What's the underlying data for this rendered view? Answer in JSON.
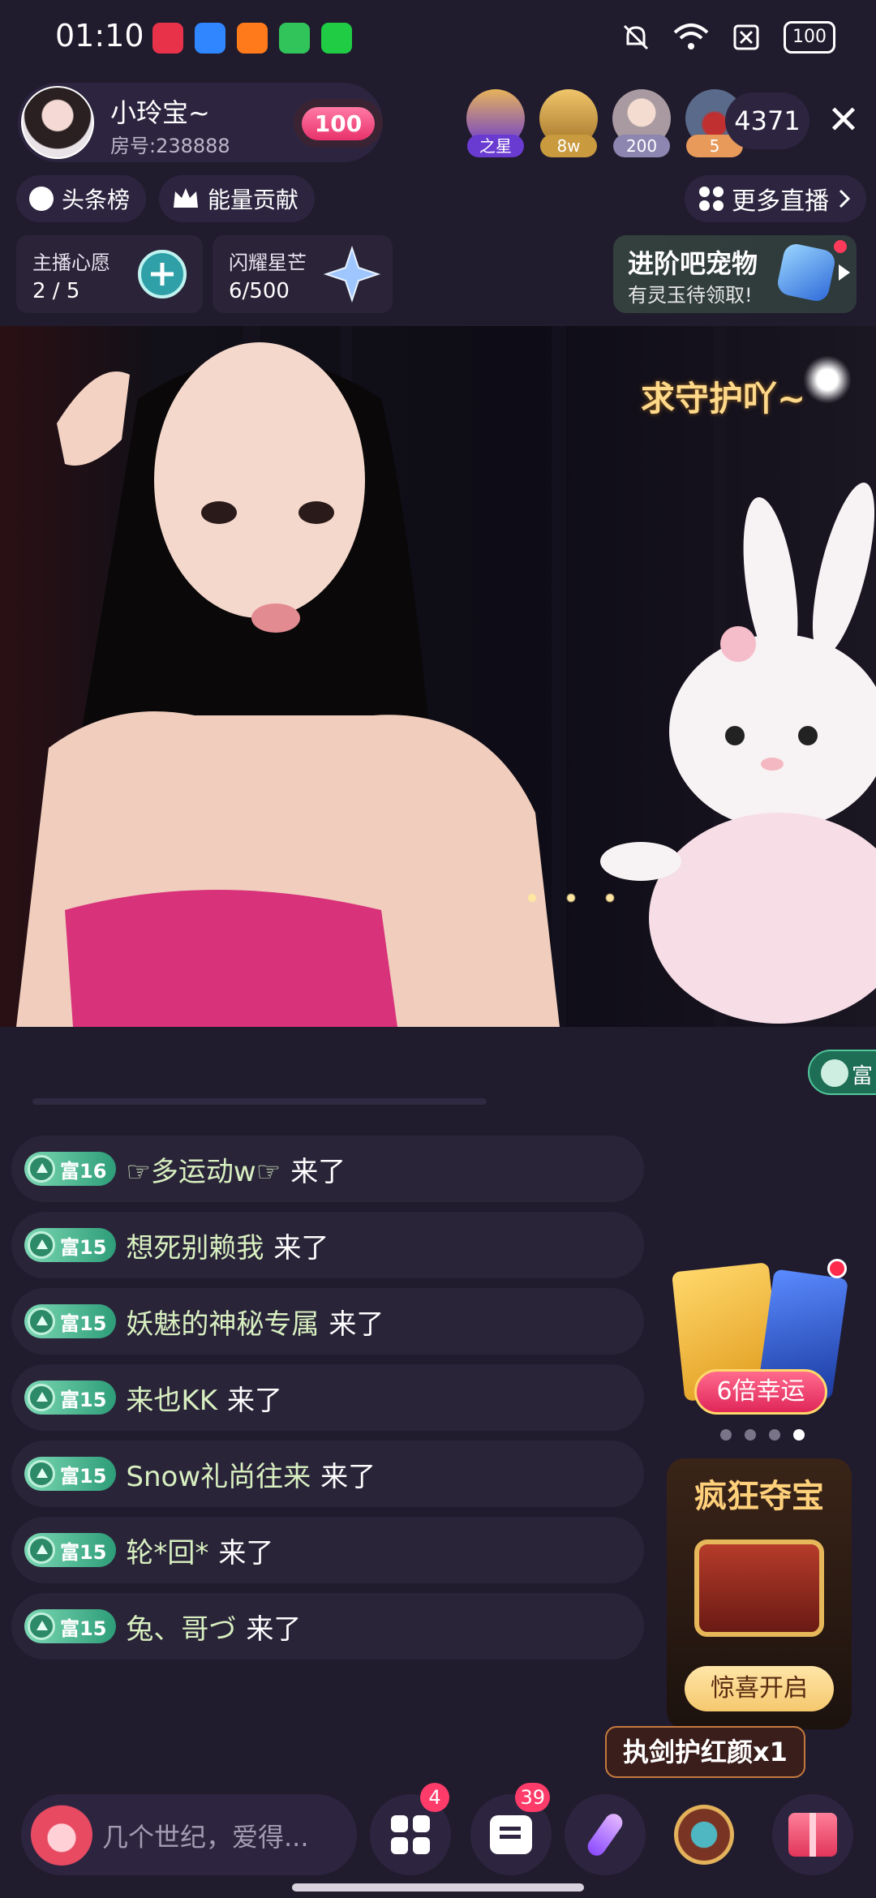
{
  "status_bar": {
    "time": "01:10",
    "battery": "100",
    "icons": [
      "app-icon-1",
      "app-icon-2",
      "app-icon-3",
      "app-icon-4",
      "app-icon-5",
      "mute-icon",
      "wifi-icon",
      "sim-icon",
      "battery-icon"
    ]
  },
  "header": {
    "host_name": "小玲宝~",
    "room_no": "房号:238888",
    "heart_value": "100",
    "viewers": [
      {
        "tag": "之星",
        "color": "#6a3bd1"
      },
      {
        "tag": "8w",
        "color": "#c99a3e"
      },
      {
        "tag": "200",
        "color": "#8c86b0"
      },
      {
        "tag": "5",
        "color": "#e79a5a"
      }
    ],
    "viewer_count": "4371",
    "close": "✕"
  },
  "rank": {
    "headline": "头条榜",
    "energy": "能量贡献",
    "more_live": "更多直播"
  },
  "tasks": {
    "wish_title": "主播心愿",
    "wish_progress": "2 / 5",
    "star_title": "闪耀星芒",
    "star_progress": "6/500"
  },
  "pet": {
    "title": "进阶吧宠物",
    "subtitle": "有灵玉待领取!"
  },
  "video": {
    "caption": "求守护吖~"
  },
  "chat": {
    "noble_label": "富",
    "messages": [
      {
        "level": "富16",
        "user": "☞多运动w☞",
        "action": "来了"
      },
      {
        "level": "富15",
        "user": "想死别赖我",
        "action": "来了"
      },
      {
        "level": "富15",
        "user": "妖魅的神秘专属",
        "action": "来了"
      },
      {
        "level": "富15",
        "user": "来也KK",
        "action": "来了"
      },
      {
        "level": "富15",
        "user": "Snow礼尚往来",
        "action": "来了"
      },
      {
        "level": "富15",
        "user": "轮*回*",
        "action": "来了"
      },
      {
        "level": "富15",
        "user": "兔、哥づ",
        "action": "来了"
      }
    ]
  },
  "widgets": {
    "luck_label": "6倍幸运",
    "treasure_title": "疯狂夺宝",
    "treasure_button": "惊喜开启",
    "gift_tip": "执剑护红颜x1"
  },
  "bottom": {
    "input_placeholder": "几个世纪，爱得...",
    "apps_badge": "4",
    "message_badge": "39"
  }
}
